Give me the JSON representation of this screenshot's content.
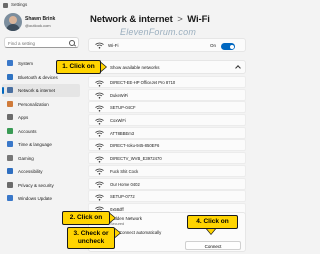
{
  "window": {
    "title": "Settings"
  },
  "user": {
    "name": "Shawn Brink",
    "email": "@outlook.com"
  },
  "search": {
    "placeholder": "Find a setting"
  },
  "sidebar": {
    "items": [
      {
        "label": "System",
        "color": "#3a78c9"
      },
      {
        "label": "Bluetooth & devices",
        "color": "#2f73c2"
      },
      {
        "label": "Network & internet",
        "color": "#4a6fa0"
      },
      {
        "label": "Personalization",
        "color": "#d07b3a"
      },
      {
        "label": "Apps",
        "color": "#6b6b6b"
      },
      {
        "label": "Accounts",
        "color": "#3a9b55"
      },
      {
        "label": "Time & language",
        "color": "#3a78c9"
      },
      {
        "label": "Gaming",
        "color": "#777777"
      },
      {
        "label": "Accessibility",
        "color": "#2f6fc0"
      },
      {
        "label": "Privacy & security",
        "color": "#6b6b6b"
      },
      {
        "label": "Windows Update",
        "color": "#3a78c9"
      }
    ]
  },
  "header": {
    "parent": "Network & internet",
    "separator": ">",
    "current": "Wi-Fi"
  },
  "watermark": "ElevenForum.com",
  "wifi": {
    "label": "Wi-Fi",
    "state": "On"
  },
  "show_networks": {
    "label": "Show available networks"
  },
  "networks": [
    "DIRECT-EE-HP OfficeJet Pro 8710",
    "DukeWiFi",
    "SETUP-04CF",
    "CoxWiFi",
    "ATT8BBEm3",
    "DIRECT-roku-945-850EF6",
    "DIRECTV_WVB_E3972470",
    "Fuck Shit Cock",
    "Our Home 0402",
    "SETUP-0772",
    "0x58dff"
  ],
  "hidden_network": {
    "label": "Hidden Network",
    "sub": "Secured",
    "checkbox_label": "Connect automatically",
    "connect_label": "Connect"
  },
  "callouts": {
    "c1": "1. Click on",
    "c2": "2. Click on",
    "c3_line1": "3. Check or",
    "c3_line2": "uncheck",
    "c4": "4. Click on"
  }
}
